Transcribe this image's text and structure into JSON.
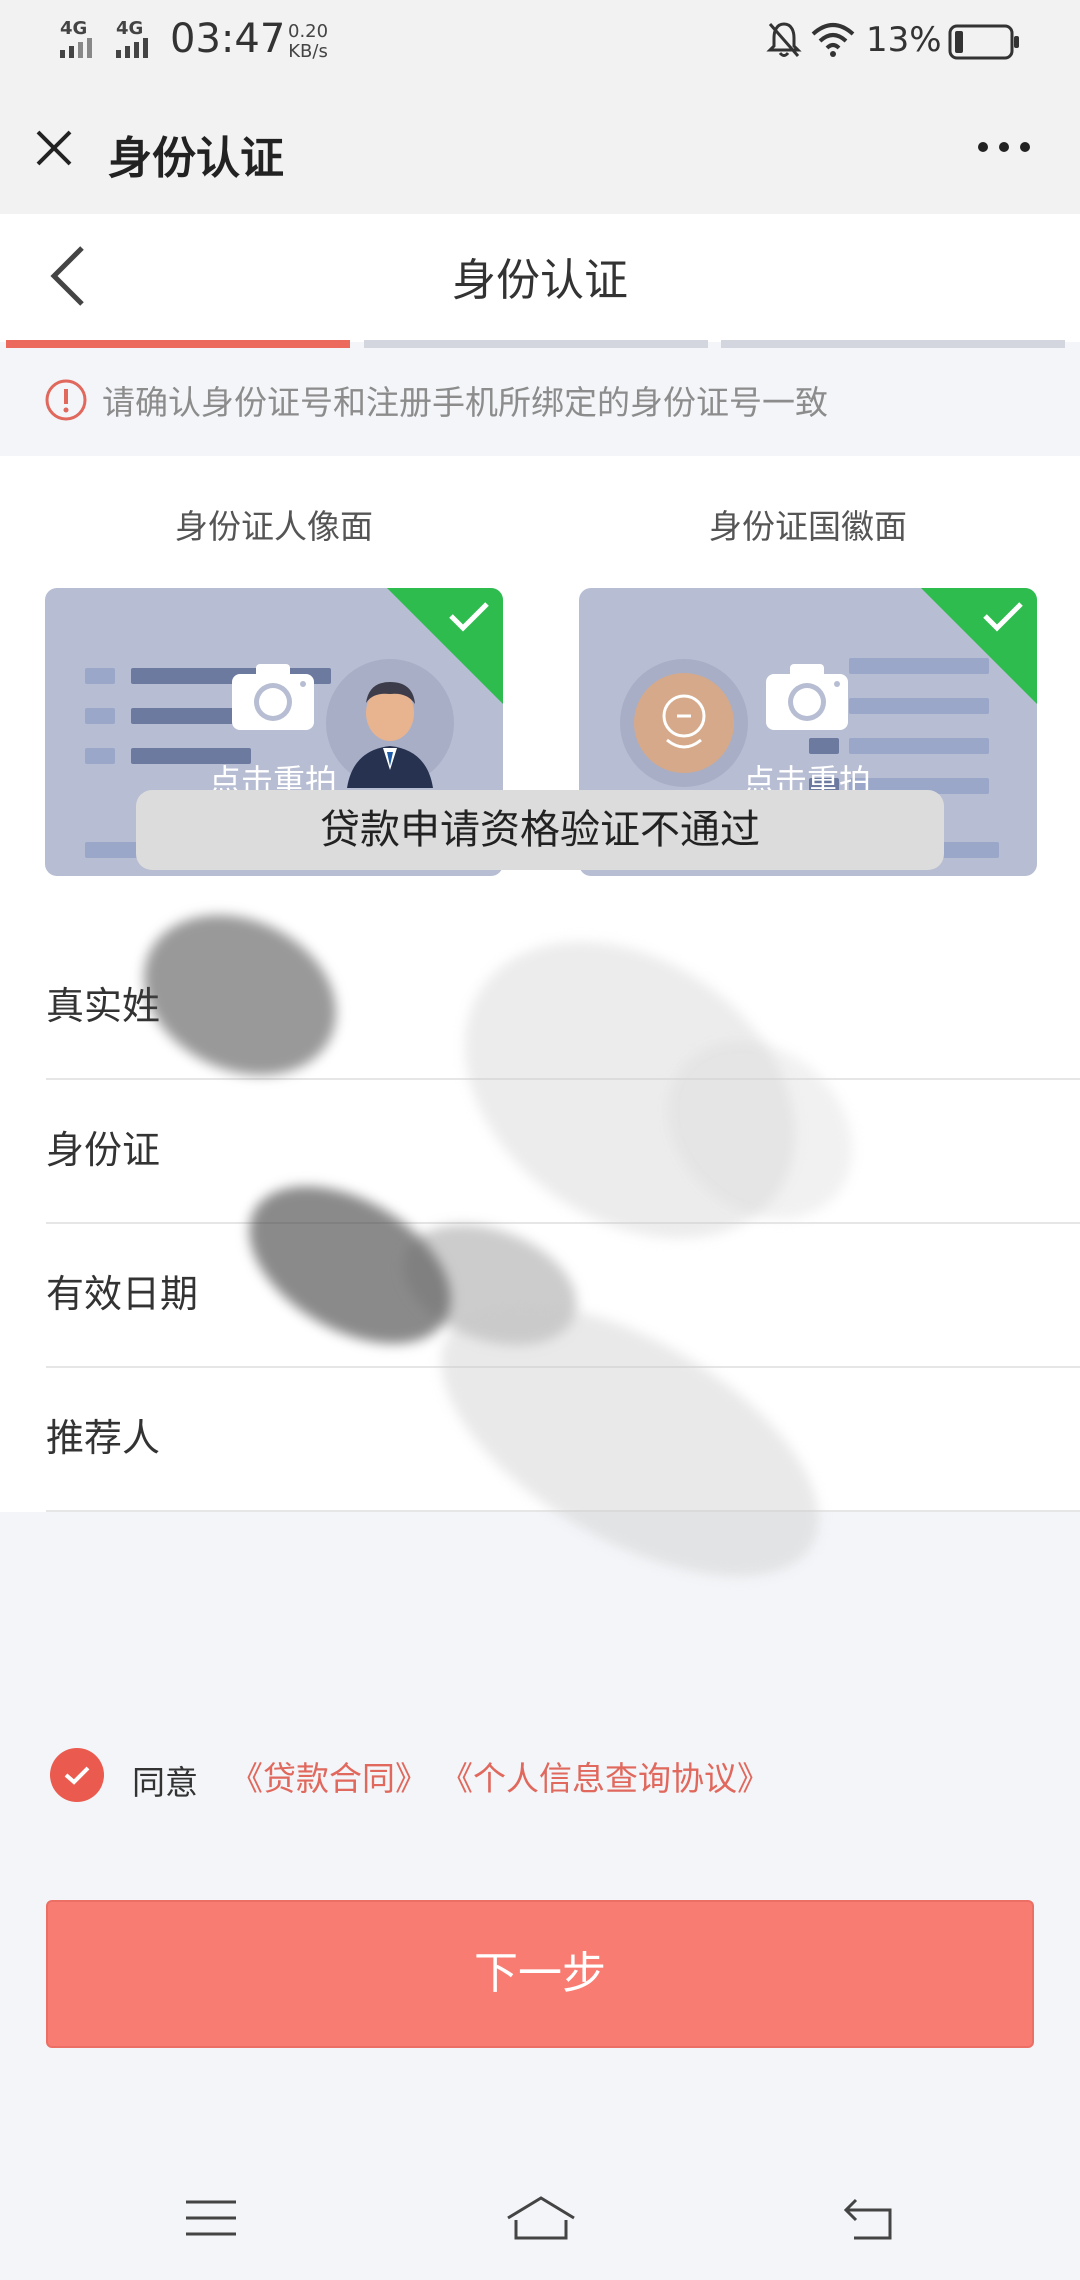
{
  "status_bar": {
    "network_1": "4G",
    "network_2": "4G",
    "time": "03:47",
    "speed_value": "0.20",
    "speed_unit": "KB/s",
    "battery": "13%",
    "icons": [
      "signal-icon",
      "signal-icon",
      "mute-bell-icon",
      "wifi-icon",
      "battery-icon"
    ]
  },
  "app_bar": {
    "title": "身份认证",
    "close_icon": "close-icon",
    "more_icon": "more-dots-icon"
  },
  "page_header": {
    "title": "身份认证",
    "back_icon": "chevron-left-icon",
    "steps": [
      {
        "state": "active",
        "color": "#eb6a5d"
      },
      {
        "state": "inactive",
        "color": "#d4d6df"
      },
      {
        "state": "inactive",
        "color": "#d4d6df"
      }
    ]
  },
  "notice": {
    "icon": "alert-circle-icon",
    "text": "请确认身份证号和注册手机所绑定的身份证号一致"
  },
  "id_cards": [
    {
      "label": "身份证人像面",
      "retake": "点击重拍",
      "uploaded": true
    },
    {
      "label": "身份证国徽面",
      "retake": "点击重拍",
      "uploaded": true
    }
  ],
  "toast": "贷款申请资格验证不通过",
  "form": {
    "rows": [
      {
        "label": "真实姓",
        "value": ""
      },
      {
        "label": "身份证",
        "value": ""
      },
      {
        "label": "有效日期",
        "value": ""
      },
      {
        "label": "推荐人",
        "value": ""
      }
    ]
  },
  "agreement": {
    "checked": true,
    "prefix": "同意",
    "contract_link": "《贷款合同》",
    "query_link": "《个人信息查询协议》"
  },
  "next_button": "下一步",
  "nav_bar": {
    "icons": [
      "menu-icon",
      "home-icon",
      "back-icon"
    ]
  },
  "colors": {
    "accent": "#eb6a5d",
    "button": "#f97c73",
    "success": "#2ebc4f"
  }
}
